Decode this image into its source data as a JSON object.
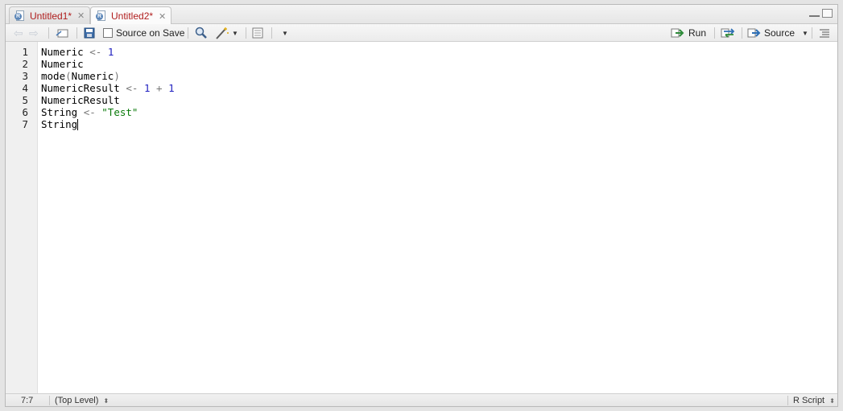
{
  "tabs": [
    {
      "label": "Untitled1*",
      "active": false
    },
    {
      "label": "Untitled2*",
      "active": true
    }
  ],
  "toolbar": {
    "source_on_save": "Source on Save",
    "source_on_save_checked": false,
    "run": "Run",
    "source": "Source"
  },
  "editor": {
    "line_numbers": [
      "1",
      "2",
      "3",
      "4",
      "5",
      "6",
      "7"
    ],
    "lines": [
      [
        {
          "t": "Numeric ",
          "c": ""
        },
        {
          "t": "<-",
          "c": "op"
        },
        {
          "t": " ",
          "c": ""
        },
        {
          "t": "1",
          "c": "num"
        }
      ],
      [
        {
          "t": "Numeric",
          "c": ""
        }
      ],
      [
        {
          "t": "mode",
          "c": ""
        },
        {
          "t": "(",
          "c": "op"
        },
        {
          "t": "Numeric",
          "c": ""
        },
        {
          "t": ")",
          "c": "op"
        }
      ],
      [
        {
          "t": "NumericResult ",
          "c": ""
        },
        {
          "t": "<-",
          "c": "op"
        },
        {
          "t": " ",
          "c": ""
        },
        {
          "t": "1",
          "c": "num"
        },
        {
          "t": " ",
          "c": ""
        },
        {
          "t": "+",
          "c": "op"
        },
        {
          "t": " ",
          "c": ""
        },
        {
          "t": "1",
          "c": "num"
        }
      ],
      [
        {
          "t": "NumericResult",
          "c": ""
        }
      ],
      [
        {
          "t": "String ",
          "c": ""
        },
        {
          "t": "<-",
          "c": "op"
        },
        {
          "t": " ",
          "c": ""
        },
        {
          "t": "\"Test\"",
          "c": "str"
        }
      ],
      [
        {
          "t": "String",
          "c": ""
        }
      ]
    ]
  },
  "status": {
    "position": "7:7",
    "scope": "(Top Level)",
    "file_type": "R Script"
  },
  "colors": {
    "tab_text": "#b01d1d",
    "number": "#1f1fbf",
    "string": "#0a7a0a",
    "operator": "#777777"
  }
}
